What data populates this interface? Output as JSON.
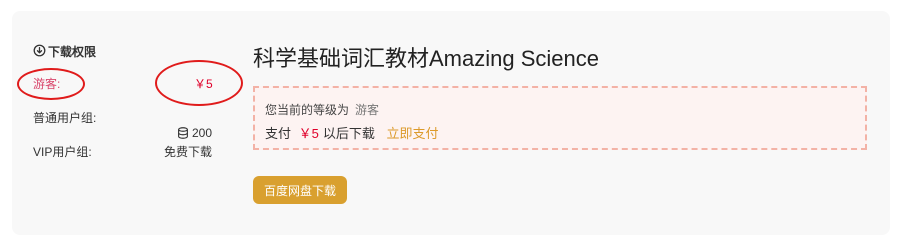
{
  "permissions": {
    "title": "下载权限",
    "guest": {
      "label": "游客:",
      "price": "￥5"
    },
    "normal": {
      "label": "普通用户组:",
      "price": "200"
    },
    "vip": {
      "label": "VIP用户组:",
      "price": "免费下载"
    }
  },
  "book": {
    "title": "科学基础词汇教材Amazing Science"
  },
  "notice": {
    "level_prefix": "您当前的等级为",
    "level_name": "游客",
    "pay_prefix": "支付",
    "pay_price": "￥5",
    "pay_suffix": "以后下载",
    "pay_link": "立即支付"
  },
  "download_button": "百度网盘下载",
  "colors": {
    "accent": "#d9a02f",
    "price": "#e0002a",
    "annotation": "#e01b1b"
  }
}
